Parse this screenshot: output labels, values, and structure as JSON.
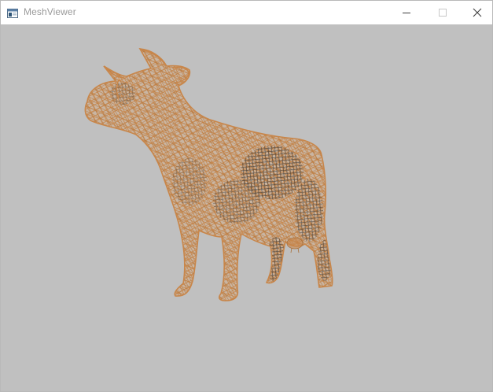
{
  "window": {
    "title": "MeshViewer",
    "icon": "app-window-icon",
    "controls": [
      "minimize-icon",
      "maximize-icon",
      "close-icon"
    ]
  },
  "viewport": {
    "background_color": "#c0c0c0",
    "mesh": {
      "subject": "cow",
      "render_mode": "wireframe",
      "wire_color": "#c8864a",
      "dark_wire_color": "#3a3632"
    }
  }
}
